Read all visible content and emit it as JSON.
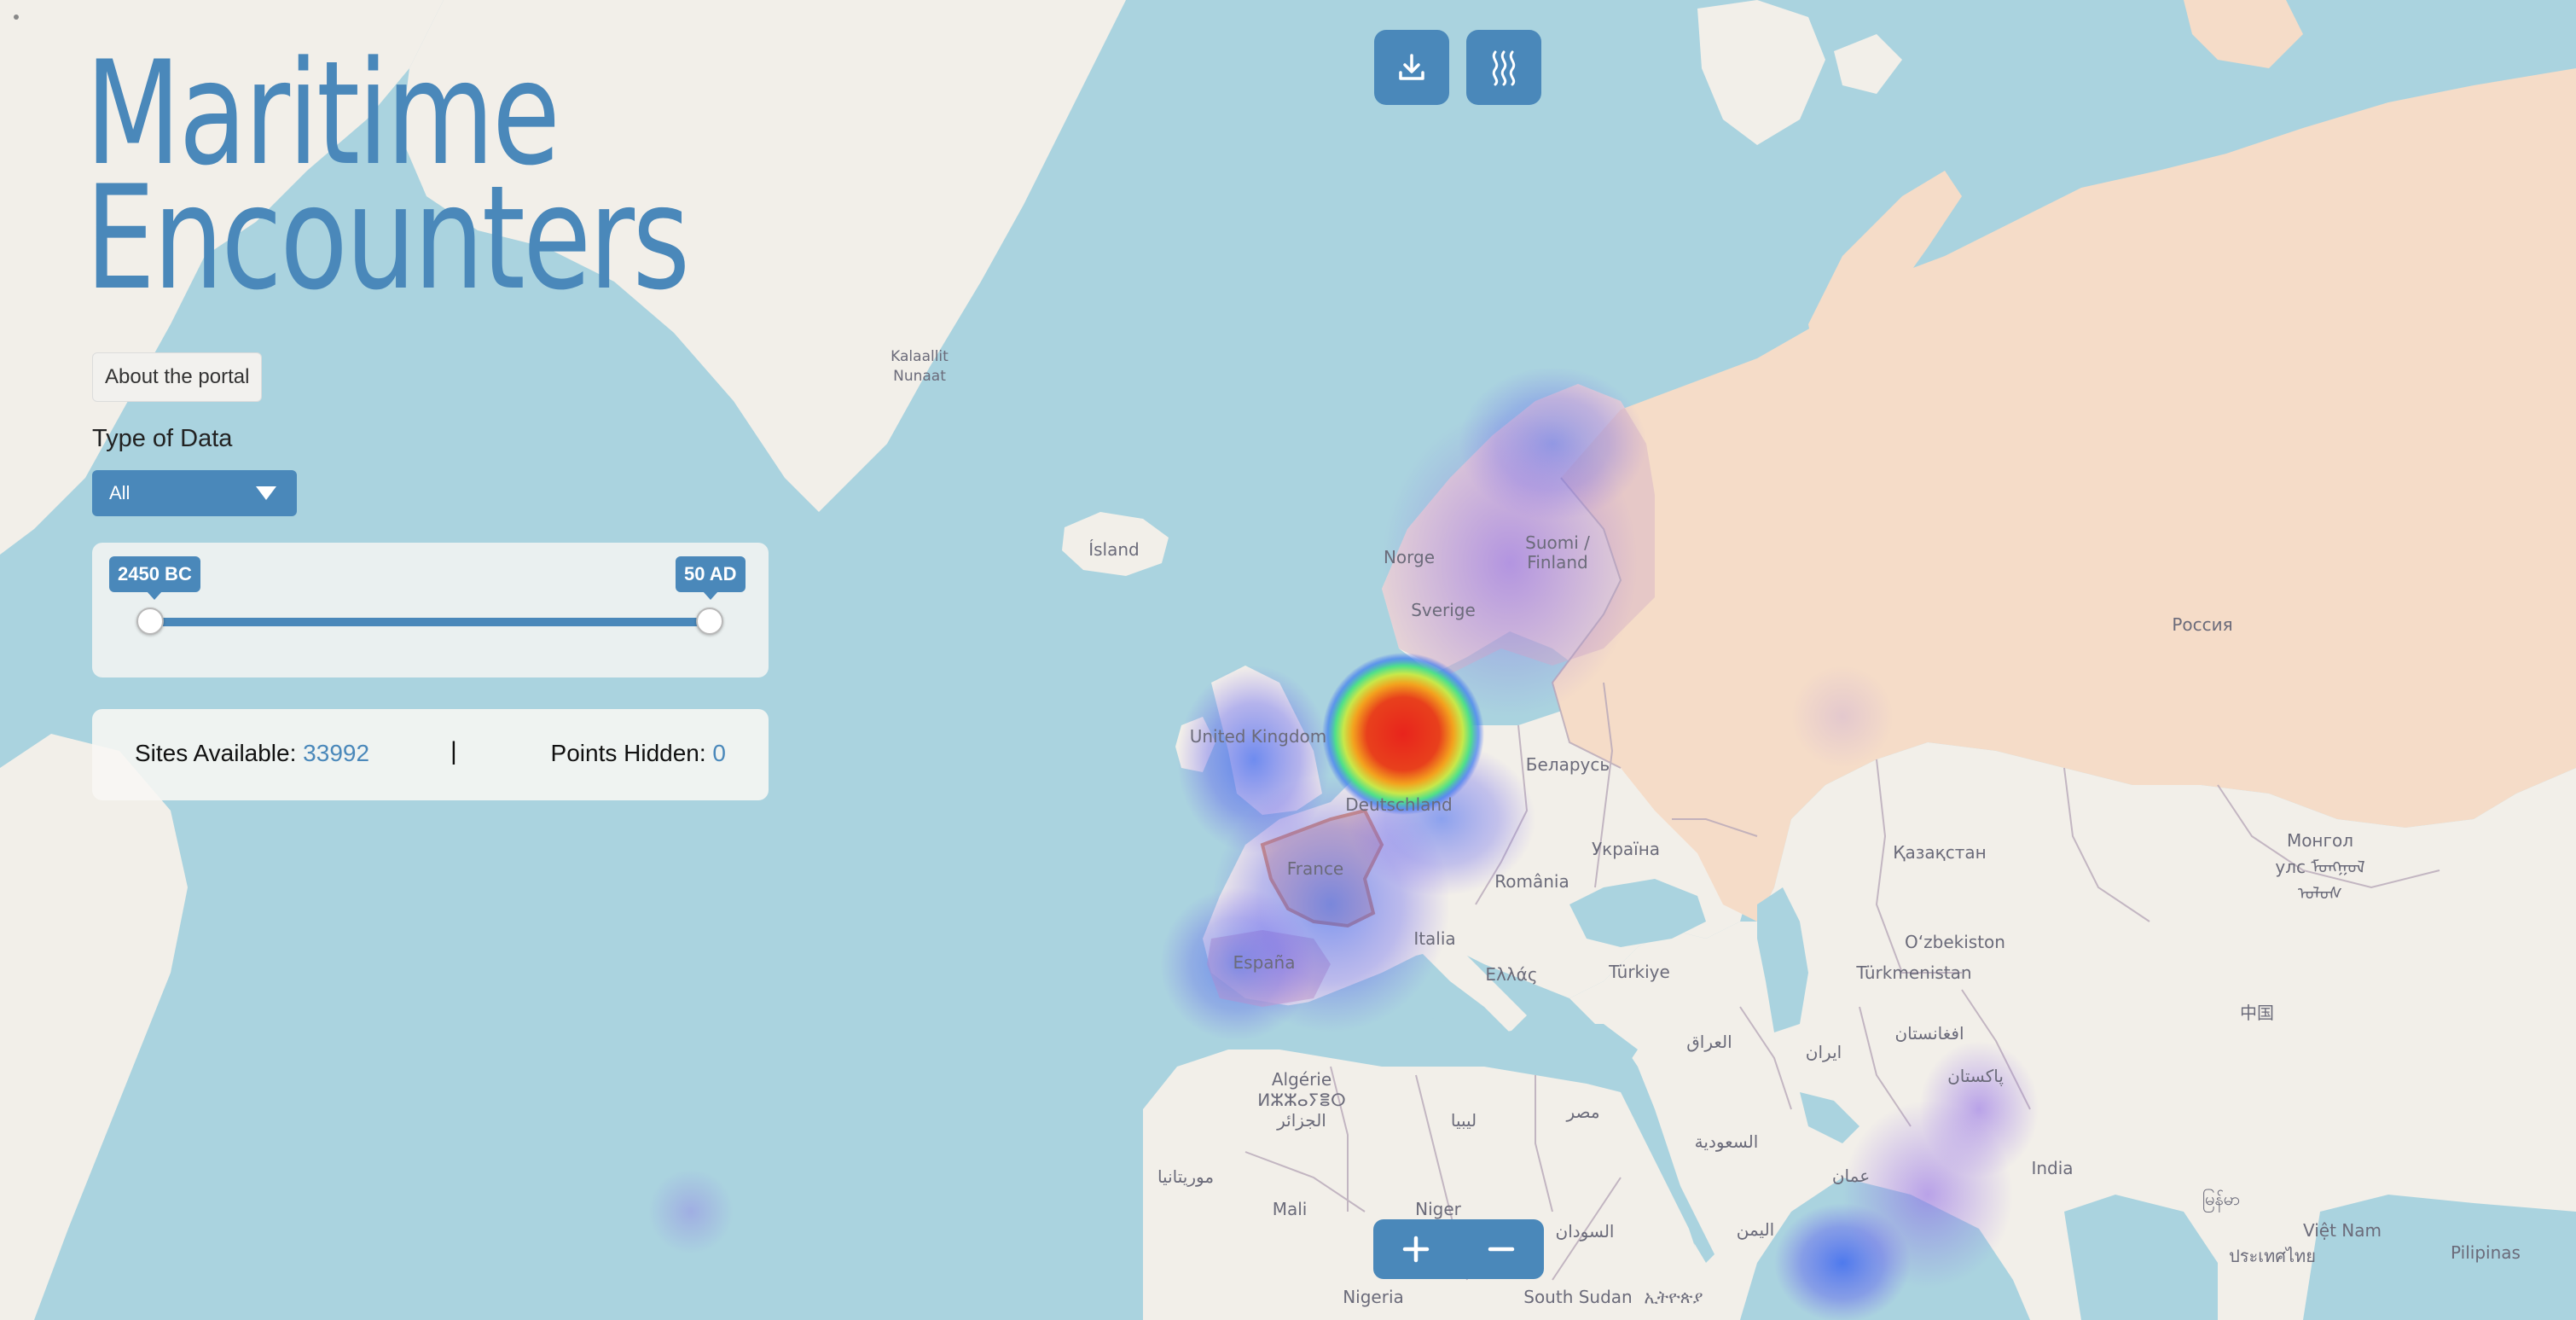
{
  "app": {
    "title_line1": "Maritime",
    "title_line2": "Encounters",
    "about_label": "About the portal"
  },
  "filters": {
    "type_label": "Type of Data",
    "type_selected": "All"
  },
  "time_range": {
    "start_label": "2450 BC",
    "end_label": "50 AD"
  },
  "stats": {
    "sites_label": "Sites Available:",
    "sites_value": "33992",
    "separator": "|",
    "hidden_label": "Points Hidden:",
    "hidden_value": "0"
  },
  "toolbar": {
    "download_icon": "download-icon",
    "heatmap_icon": "heat-waves-icon"
  },
  "zoom": {
    "in_label": "+",
    "out_label": "−"
  },
  "map_labels": {
    "greenland": "Kalaallit Nunaat",
    "iceland": "Ísland",
    "norway": "Norge",
    "sweden": "Sverige",
    "finland": "Suomi / Finland",
    "uk": "United Kingdom",
    "germany": "Deutschland",
    "belarus": "Беларусь",
    "ukraine": "Україна",
    "france": "France",
    "romania": "România",
    "spain": "España",
    "italy": "Italia",
    "greece": "Ελλάς",
    "turkey": "Türkiye",
    "russia": "Россия",
    "kazakhstan": "Қазақстан",
    "mongolia": "Монгол улс ᠮᠣᠩᠭᠣᠯ ᠤᠯᠤᠰ",
    "uzbekistan": "O‘zbekiston",
    "turkmenistan": "Türkmenistan",
    "algeria": "Algérie ⵍⵣⵣⴰⵢⴻⵔ الجزائر",
    "libya": "ليبيا",
    "egypt": "مصر",
    "iraq": "العراق",
    "iran": "ایران",
    "afghanistan": "افغانستان",
    "pakistan": "پاکستان",
    "china": "中国",
    "saudi": "السعودية",
    "oman": "عمان",
    "yemen": "اليمن",
    "mauritania": "موريتانيا",
    "mali": "Mali",
    "niger": "Niger",
    "sudan": "السودان",
    "south_sudan": "South Sudan",
    "ethiopia": "ኢትዮጵያ",
    "nigeria": "Nigeria",
    "india": "India",
    "myanmar": "မြန်မာ",
    "vietnam": "Việt Nam",
    "thailand": "ประเทศไทย",
    "philippines": "Pilipinas"
  }
}
